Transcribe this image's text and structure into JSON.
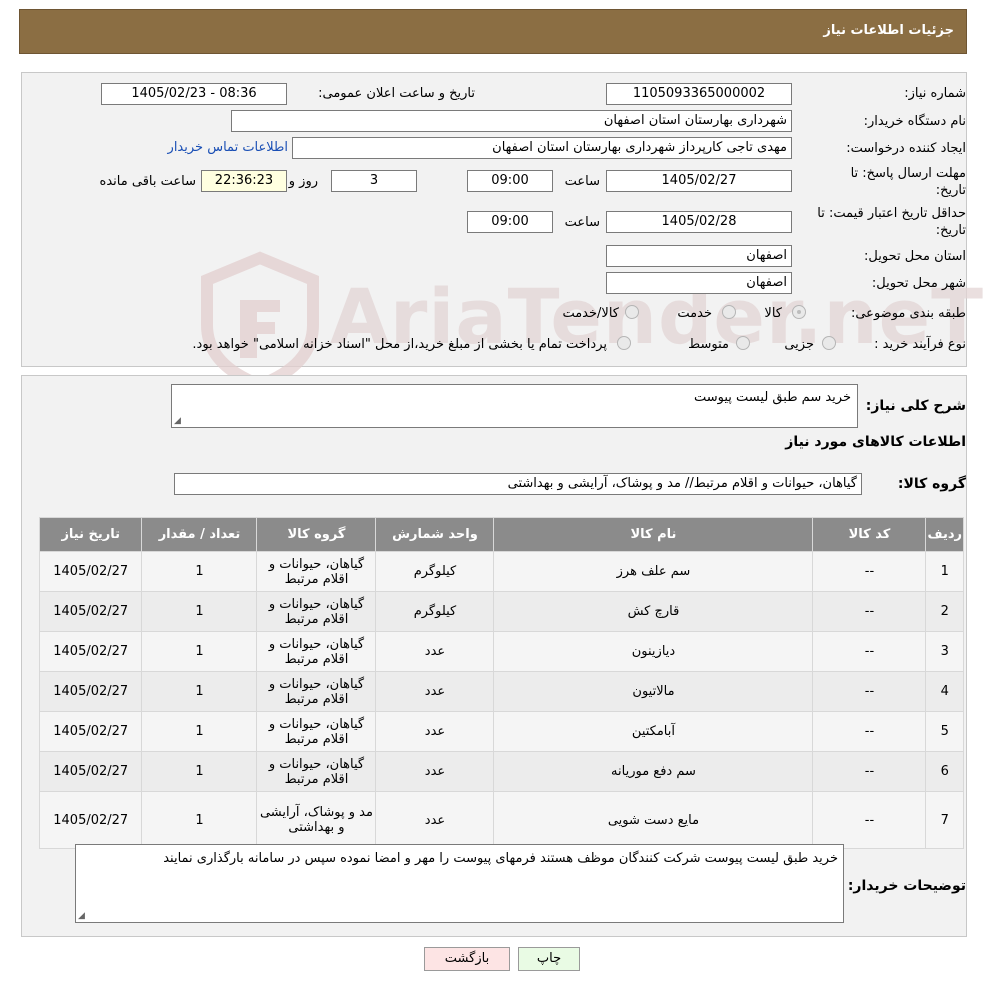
{
  "header": {
    "title": "جزئیات اطلاعات نیاز"
  },
  "form": {
    "need_number_label": "شماره نیاز:",
    "need_number": "1105093365000002",
    "announce_label": "تاریخ و ساعت اعلان عمومی:",
    "announce_value": "1405/02/23 - 08:36",
    "buyer_org_label": "نام دستگاه خریدار:",
    "buyer_org": "شهرداری بهارستان استان اصفهان",
    "creator_label": "ایجاد کننده درخواست:",
    "creator": "مهدی تاجی کارپرداز شهرداری بهارستان استان اصفهان",
    "contact_link": "اطلاعات تماس خریدار",
    "deadline_label_1": "مهلت ارسال پاسخ: تا",
    "deadline_label_2": "تاریخ:",
    "deadline_date": "1405/02/27",
    "time_word": "ساعت",
    "deadline_time": "09:00",
    "days_value": "3",
    "days_word": "روز و",
    "remaining_time": "22:36:23",
    "remaining_label": "ساعت باقی مانده",
    "price_valid_label_1": "حداقل تاریخ اعتبار قیمت: تا",
    "price_valid_label_2": "تاریخ:",
    "price_valid_date": "1405/02/28",
    "price_valid_time": "09:00",
    "province_label": "استان محل تحویل:",
    "province": "اصفهان",
    "city_label": "شهر محل تحویل:",
    "city": "اصفهان",
    "category_label": "طبقه بندی موضوعی:",
    "category_options": [
      "کالا",
      "خدمت",
      "کالا/خدمت"
    ],
    "process_label": "نوع فرآیند خرید :",
    "process_options": [
      "جزیی",
      "متوسط"
    ],
    "process_note": "پرداخت تمام یا بخشی از مبلغ خرید،از محل \"اسناد خزانه اسلامی\" خواهد بود."
  },
  "watermark": {
    "text": "AriaTender.neT"
  },
  "details": {
    "summary_label": "شرح کلی نیاز:",
    "summary_value": "خرید سم طبق لیست پیوست",
    "goods_info_title": "اطلاعات کالاهای مورد نیاز",
    "group_label": "گروه کالا:",
    "group_value": "گیاهان، حیوانات و اقلام مرتبط// مد و پوشاک، آرایشی و بهداشتی"
  },
  "table": {
    "headers": [
      "ردیف",
      "کد کالا",
      "نام کالا",
      "واحد شمارش",
      "گروه کالا",
      "تعداد / مقدار",
      "تاریخ نیاز"
    ],
    "rows": [
      {
        "row": "1",
        "code": "--",
        "name": "سم علف هرز",
        "unit": "کیلوگرم",
        "group": "گیاهان، حیوانات و اقلام مرتبط",
        "qty": "1",
        "date": "1405/02/27"
      },
      {
        "row": "2",
        "code": "--",
        "name": "قارچ کش",
        "unit": "کیلوگرم",
        "group": "گیاهان، حیوانات و اقلام مرتبط",
        "qty": "1",
        "date": "1405/02/27"
      },
      {
        "row": "3",
        "code": "--",
        "name": "دیازینون",
        "unit": "عدد",
        "group": "گیاهان، حیوانات و اقلام مرتبط",
        "qty": "1",
        "date": "1405/02/27"
      },
      {
        "row": "4",
        "code": "--",
        "name": "مالاتیون",
        "unit": "عدد",
        "group": "گیاهان، حیوانات و اقلام مرتبط",
        "qty": "1",
        "date": "1405/02/27"
      },
      {
        "row": "5",
        "code": "--",
        "name": "آبامکتین",
        "unit": "عدد",
        "group": "گیاهان، حیوانات و اقلام مرتبط",
        "qty": "1",
        "date": "1405/02/27"
      },
      {
        "row": "6",
        "code": "--",
        "name": "سم دفع موریانه",
        "unit": "عدد",
        "group": "گیاهان، حیوانات و اقلام مرتبط",
        "qty": "1",
        "date": "1405/02/27"
      },
      {
        "row": "7",
        "code": "--",
        "name": "مایع دست شویی",
        "unit": "عدد",
        "group": "مد و پوشاک، آرایشی و بهداشتی",
        "qty": "1",
        "date": "1405/02/27"
      }
    ]
  },
  "buyer_notes": {
    "label": "توضیحات خریدار:",
    "value": "خرید طبق لیست پیوست شرکت کنندگان موظف هستند فرمهای پیوست را مهر و امضا نموده سپس در سامانه بارگذاری نمایند"
  },
  "buttons": {
    "print": "چاپ",
    "back": "بازگشت"
  },
  "colors": {
    "header_bg": "#8b6e43",
    "table_header_bg": "#8b8b8b",
    "back_btn_bg": "#fde4e4",
    "print_btn_bg": "#e9fbe4",
    "link": "#1a4fb5"
  }
}
